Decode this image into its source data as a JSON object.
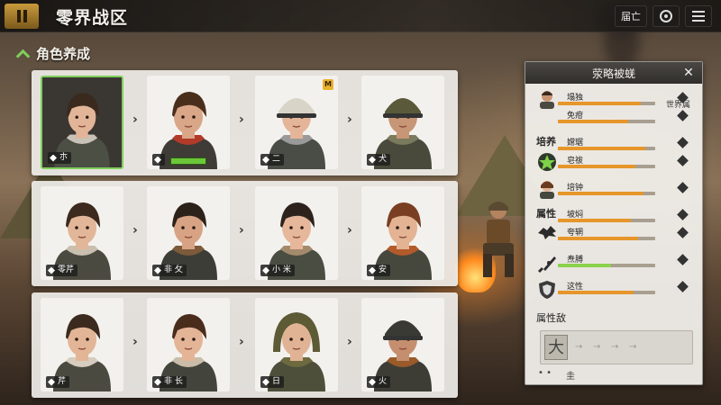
{
  "header": {
    "title": "零界战区",
    "right_button": "届亡"
  },
  "section": {
    "title": "角色养成"
  },
  "rows": [
    {
      "cards": [
        {
          "tag": "朩",
          "selected": true,
          "hair": "#3a2a1e",
          "skin": "#e2b598",
          "suit": "#4b4f44",
          "accent": "#c9c2b6"
        },
        {
          "tag": "",
          "hair": "#4a2e1c",
          "skin": "#d9a687",
          "suit": "#3f3b36",
          "accent": "#b23a28",
          "bar": true
        },
        {
          "tag": "二",
          "hair": "#d8d4c8",
          "skin": "#e4b599",
          "suit": "#4a4d45",
          "accent": "#9a9a9a",
          "helmet": true,
          "badge": "M"
        },
        {
          "tag": "犬",
          "hair": "#5a5a3a",
          "skin": "#c79677",
          "suit": "#4a4a3c",
          "accent": "#7a7a5c",
          "helmet": true
        }
      ]
    },
    {
      "cards": [
        {
          "tag": "零芹",
          "hair": "#3b2a1d",
          "skin": "#e2b698",
          "suit": "#4b4a40",
          "accent": "#c9bfae"
        },
        {
          "tag": "非 攵",
          "hair": "#2d221a",
          "skin": "#d7a384",
          "suit": "#3c3d37",
          "accent": "#7c5a3a"
        },
        {
          "tag": "小 米",
          "hair": "#2e231c",
          "skin": "#e6b79b",
          "suit": "#4a4d42",
          "accent": "#a48a6c"
        },
        {
          "tag": "安",
          "hair": "#7a3f22",
          "skin": "#e3b394",
          "suit": "#46483e",
          "accent": "#b35a2a"
        }
      ]
    },
    {
      "cards": [
        {
          "tag": "芹",
          "hair": "#3b2a1e",
          "skin": "#e3b597",
          "suit": "#4b4a40",
          "accent": "#d6cdbf"
        },
        {
          "tag": "非 长",
          "hair": "#4a2c1c",
          "skin": "#e4b497",
          "suit": "#43453c",
          "accent": "#c9bda9"
        },
        {
          "tag": "日",
          "hair": "#5d5a36",
          "skin": "#e1b395",
          "suit": "#4d4f3b",
          "accent": "#6d6a40",
          "hood": true
        },
        {
          "tag": "火",
          "hair": "#3a3a34",
          "skin": "#c58f6f",
          "suit": "#3d3d36",
          "accent": "#9a5a2a",
          "helmet": true
        }
      ]
    }
  ],
  "panel": {
    "title": "荥略被蜣",
    "world_label": "世界属",
    "groups": {
      "cultivate": "培养",
      "attribute": "属性"
    },
    "stats": [
      {
        "name": "塌独",
        "level": 0.85,
        "color": "#e6962a"
      },
      {
        "name": "免疳",
        "level": 0.72,
        "color": "#e6962a"
      },
      {
        "name": "嫦琚",
        "level": 0.9,
        "color": "#e6962a"
      },
      {
        "name": "皂祓",
        "level": 0.8,
        "color": "#e6962a"
      },
      {
        "name": "培钟",
        "level": 0.88,
        "color": "#e6962a"
      },
      {
        "name": "坡焖",
        "level": 0.75,
        "color": "#e6962a"
      },
      {
        "name": "夸辋",
        "level": 0.82,
        "color": "#e6962a"
      },
      {
        "name": "焘膊",
        "level": 0.55,
        "color": "#8bd14a"
      },
      {
        "name": "这性",
        "level": 0.78,
        "color": "#e6962a"
      }
    ],
    "attr_title": "属性敌",
    "attr_selected": "大",
    "footer": [
      "• •",
      "圭"
    ]
  }
}
